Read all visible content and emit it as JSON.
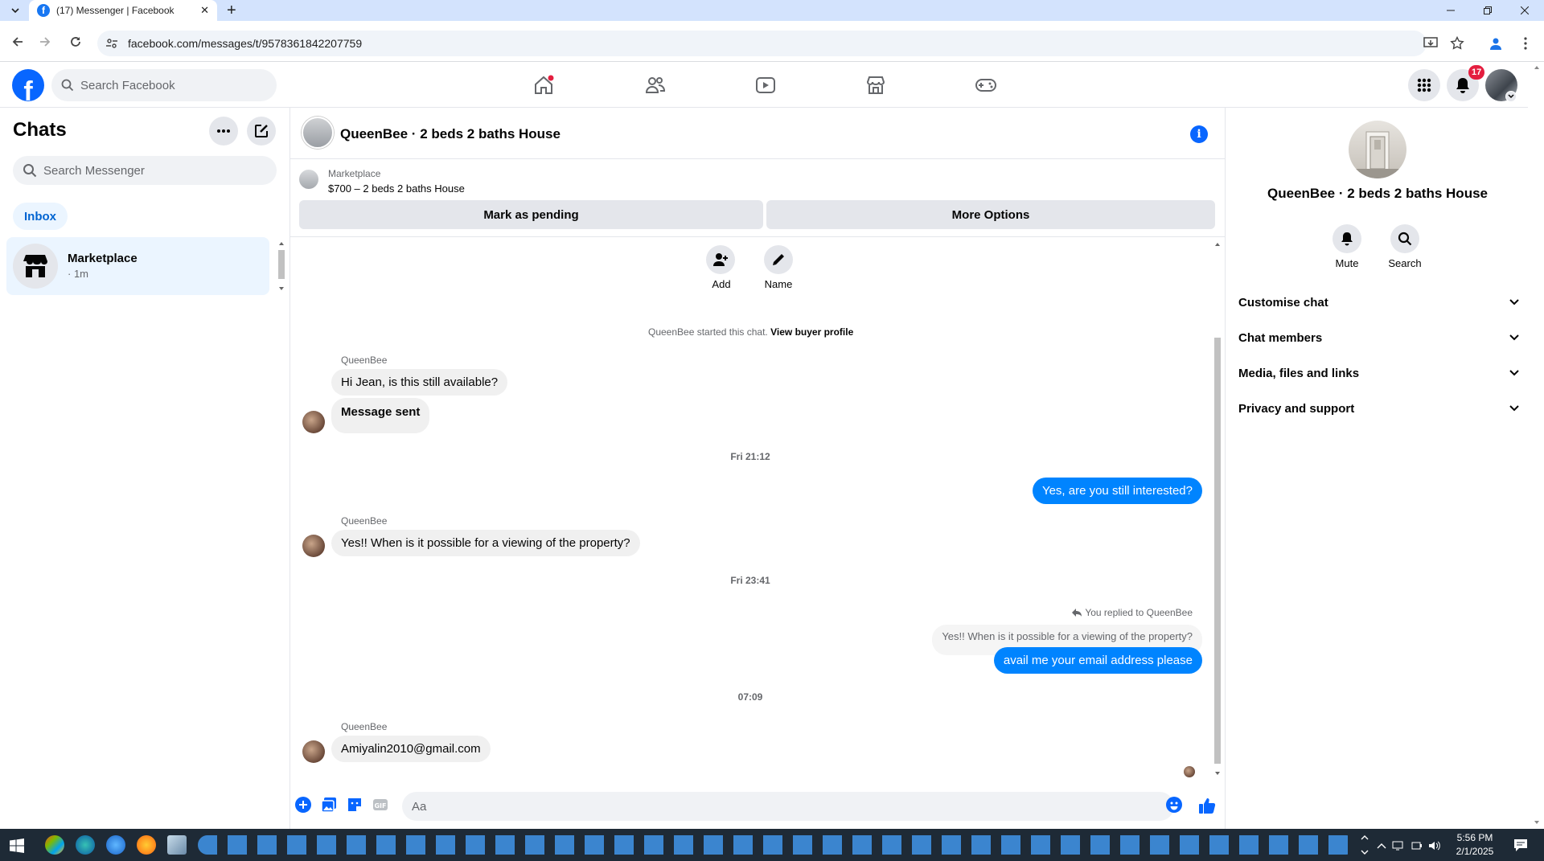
{
  "browser": {
    "tab_title": "(17) Messenger | Facebook",
    "tab_close": "✕",
    "new_tab": "+",
    "url": "facebook.com/messages/t/9578361842207759"
  },
  "fb": {
    "search_placeholder": "Search Facebook",
    "notification_count": "17"
  },
  "sidebar": {
    "title": "Chats",
    "search_placeholder": "Search Messenger",
    "filter": "Inbox",
    "conversations": [
      {
        "name": "Marketplace",
        "time": "· 1m"
      }
    ]
  },
  "chat": {
    "title": "QueenBee · 2 beds 2 baths House",
    "marketplace_label": "Marketplace",
    "listing": "$700 – 2 beds 2 baths House",
    "mark_pending": "Mark as pending",
    "more_options": "More Options",
    "add_label": "Add",
    "name_label": "Name",
    "started_text": "QueenBee started this chat.",
    "view_profile": "View buyer profile",
    "messages": [
      {
        "sender": "QueenBee",
        "text": "Hi Jean, is this still available?"
      },
      {
        "text": "Message sent"
      },
      {
        "stamp": "Fri 21:12"
      },
      {
        "text": "Yes, are you still interested?"
      },
      {
        "sender": "QueenBee",
        "text": "Yes!! When is it possible for a viewing of the property?"
      },
      {
        "stamp": "Fri 23:41"
      },
      {
        "reply_header": "You replied to QueenBee",
        "quoted": "Yes!! When is it possible for a viewing of the property?",
        "text": "avail me your email address please"
      },
      {
        "stamp": "07:09"
      },
      {
        "sender": "QueenBee",
        "text": "Amiyalin2010@gmail.com"
      }
    ],
    "composer_placeholder": "Aa"
  },
  "right_panel": {
    "title": "QueenBee · 2 beds 2 baths House",
    "mute": "Mute",
    "search": "Search",
    "sections": [
      "Customise chat",
      "Chat members",
      "Media, files and links",
      "Privacy and support"
    ]
  },
  "taskbar": {
    "time": "5:56 PM",
    "date": "2/1/2025"
  },
  "colors": {
    "accent": "#0866ff",
    "bubble_out": "#0084ff",
    "bubble_in": "#f0f0f0",
    "selected_row": "#ebf5ff",
    "badge": "#e41e3f"
  }
}
